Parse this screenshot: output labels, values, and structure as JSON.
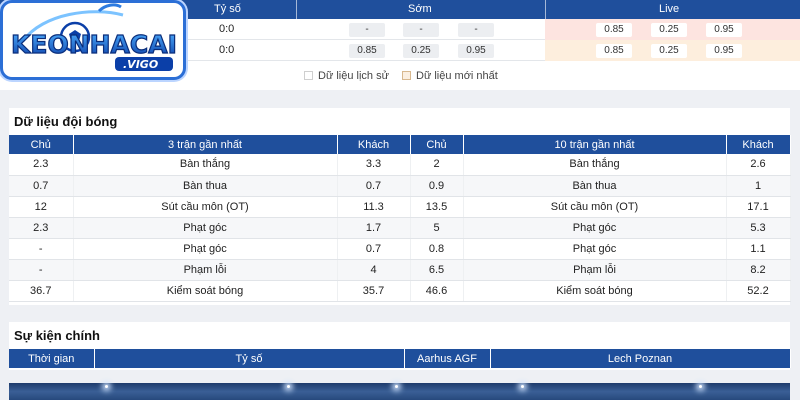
{
  "odds": {
    "header": {
      "score": "Tỷ số",
      "early": "Sớm",
      "live": "Live"
    },
    "rows": [
      {
        "score": "0:0",
        "early": [
          "-",
          "-",
          "-"
        ],
        "live": [
          "0.85",
          "0.25",
          "0.95"
        ]
      },
      {
        "score": "0:0",
        "early": [
          "0.85",
          "0.25",
          "0.95"
        ],
        "live": [
          "0.85",
          "0.25",
          "0.95"
        ]
      }
    ],
    "legend": {
      "history": "Dữ liệu lịch sử",
      "latest": "Dữ liệu mới nhất"
    }
  },
  "team_data": {
    "title": "Dữ liệu đội bóng",
    "headers": [
      "Chủ",
      "3 trận gần nhất",
      "Khách",
      "Chủ",
      "10 trận gần nhất",
      "Khách"
    ],
    "rows": [
      [
        "2.3",
        "Bàn thắng",
        "3.3",
        "2",
        "Bàn thắng",
        "2.6"
      ],
      [
        "0.7",
        "Bàn thua",
        "0.7",
        "0.9",
        "Bàn thua",
        "1"
      ],
      [
        "12",
        "Sút cầu môn (OT)",
        "11.3",
        "13.5",
        "Sút cầu môn (OT)",
        "17.1"
      ],
      [
        "2.3",
        "Phạt góc",
        "1.7",
        "5",
        "Phạt góc",
        "5.3"
      ],
      [
        "-",
        "Phạt góc",
        "0.7",
        "0.8",
        "Phạt góc",
        "1.1"
      ],
      [
        "-",
        "Phạm lỗi",
        "4",
        "6.5",
        "Phạm lỗi",
        "8.2"
      ],
      [
        "36.7",
        "Kiểm soát bóng",
        "35.7",
        "46.6",
        "Kiểm soát bóng",
        "52.2"
      ]
    ]
  },
  "events": {
    "title": "Sự kiện chính",
    "headers": [
      "Thời gian",
      "Tỷ số",
      "Aarhus AGF",
      "Lech Poznan"
    ]
  },
  "logo": {
    "text_main": "KEONHACAI",
    "text_sub": ".VIGO"
  },
  "colors": {
    "header_blue": "#1f4f9c",
    "live_row1": "#fde4e0",
    "live_row2": "#fdeedd"
  }
}
